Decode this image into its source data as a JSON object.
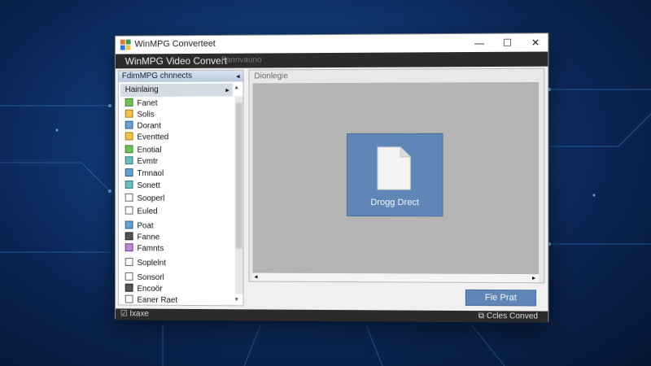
{
  "window": {
    "title": "WinMPG Converteet",
    "controls": {
      "minimize": "—",
      "maximize": "☐",
      "close": "✕"
    }
  },
  "menubar": {
    "app_name": "WinMPG Video Convert",
    "sub_label": "Fannvauno"
  },
  "left_panel": {
    "header": "FdimMPG chnnects",
    "header_arrow": "◂",
    "category": "Hainlaing",
    "category_arrow": "▸",
    "scroll_up": "▴",
    "scroll_down": "▾",
    "items": [
      {
        "label": "Fanet",
        "icon": "video-icon",
        "color": "#6fbf5a"
      },
      {
        "label": "Solis",
        "icon": "folder-icon",
        "color": "#f2c24a"
      },
      {
        "label": "Dorant",
        "icon": "document-icon",
        "color": "#6aa0d8"
      },
      {
        "label": "Eventted",
        "icon": "folder-icon",
        "color": "#f2c24a"
      },
      {
        "label": "Enotial",
        "icon": "film-icon",
        "color": "#6fbf5a"
      },
      {
        "label": "Evmtr",
        "icon": "monitor-icon",
        "color": "#6cbfbf"
      },
      {
        "label": "Tmnaol",
        "icon": "monitor-icon",
        "color": "#6aa0d8"
      },
      {
        "label": "Sonett",
        "icon": "gear-icon",
        "color": "#6cbfbf"
      },
      {
        "label": "Sooperl",
        "icon": "file-icon",
        "color": "#ffffff"
      },
      {
        "label": "Euled",
        "icon": "file-icon",
        "color": "#ffffff"
      },
      {
        "label": "Poat",
        "icon": "monitor-icon",
        "color": "#6aa0d8"
      },
      {
        "label": "Fanne",
        "icon": "tag-icon",
        "color": "#555555"
      },
      {
        "label": "Famnts",
        "icon": "video-icon",
        "color": "#b88ad0"
      },
      {
        "label": "Soplelnt",
        "icon": "file-icon",
        "color": "#ffffff"
      },
      {
        "label": "Sonsorl",
        "icon": "file-icon",
        "color": "#ffffff"
      },
      {
        "label": "Encoör",
        "icon": "encoder-icon",
        "color": "#555555"
      },
      {
        "label": "Eaner Raet",
        "icon": "file-icon",
        "color": "#ffffff"
      }
    ]
  },
  "right_panel": {
    "label": "Dionlegie",
    "drop_zone": {
      "text": "Drogg Drect"
    },
    "hscroll": {
      "left": "◂",
      "right": "▸"
    }
  },
  "action_button": {
    "label": "Fie Prat"
  },
  "statusbar": {
    "left_icon": "status-icon",
    "left_text": "Ixaxe",
    "right_text": "Ccles Conved"
  },
  "colors": {
    "accent": "#5f86b6",
    "menubar": "#2b2b2b",
    "background": "#0a2350"
  }
}
